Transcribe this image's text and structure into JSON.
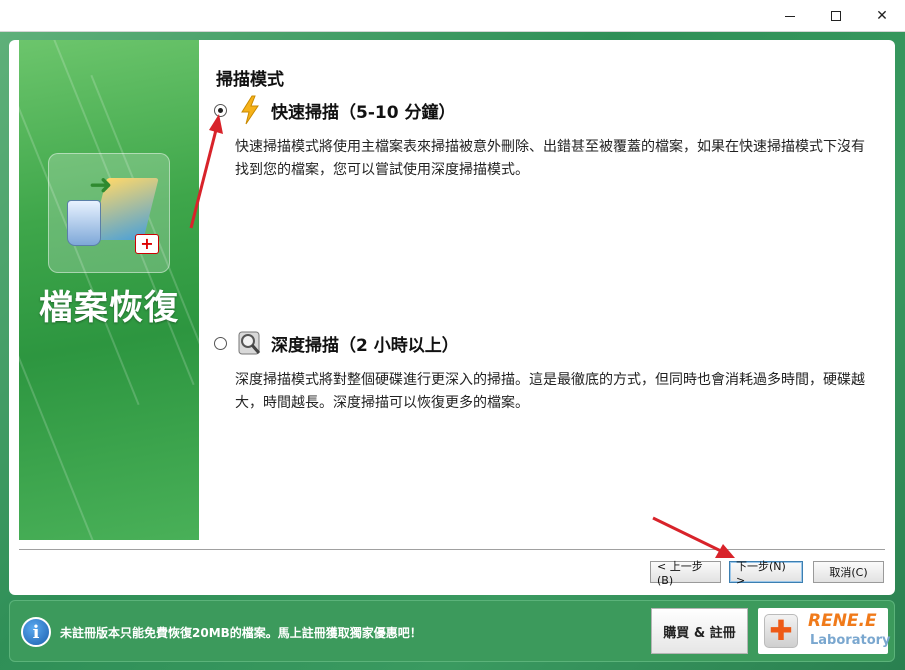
{
  "titlebar": {
    "minimize_label": "",
    "maximize_label": "",
    "close_label": "✕"
  },
  "sidebar": {
    "title": "檔案恢復"
  },
  "main": {
    "section_title": "掃描模式",
    "options": [
      {
        "label": "快速掃描（5-10 分鐘）",
        "selected": true,
        "icon": "lightning-icon",
        "description": "快速掃描模式將使用主檔案表來掃描被意外刪除、出錯甚至被覆蓋的檔案，如果在快速掃描模式下沒有找到您的檔案，您可以嘗試使用深度掃描模式。"
      },
      {
        "label": "深度掃描（2 小時以上）",
        "selected": false,
        "icon": "magnifier-disk-icon",
        "description": "深度掃描模式將對整個硬碟進行更深入的掃描。這是最徹底的方式，但同時也會消耗過多時間，硬碟越大，時間越長。深度掃描可以恢復更多的檔案。"
      }
    ]
  },
  "nav": {
    "back_label": "< 上一步(B)",
    "next_label": "下一步(N) >",
    "cancel_label": "取消(C)"
  },
  "footer": {
    "notice": "未註冊版本只能免費恢復20MB的檔案。馬上註冊獲取獨家優惠吧！",
    "buy_label": "購買 & 註冊",
    "brand_name": "RENE.E",
    "brand_sub": "Laboratory"
  },
  "colors": {
    "accent_green": "#2f8f57",
    "arrow_red": "#d8232a",
    "brand_orange": "#f07a1a"
  }
}
